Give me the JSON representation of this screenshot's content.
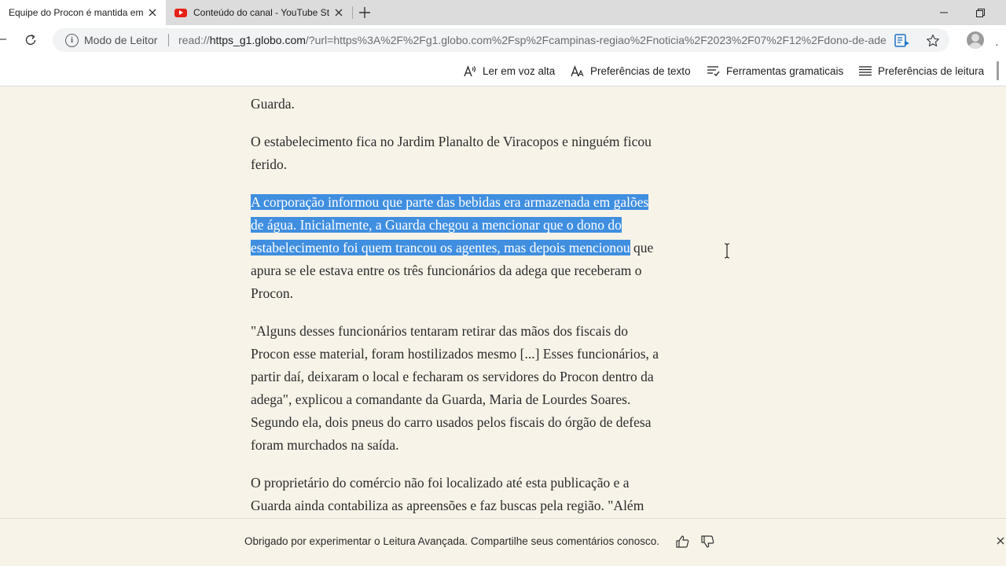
{
  "tabs": [
    {
      "title": "Equipe do Procon é mantida em",
      "active": true
    },
    {
      "title": "Conteúdo do canal - YouTube St",
      "active": false,
      "icon": "youtube-icon"
    }
  ],
  "address_bar": {
    "reader_label": "Modo de Leitor",
    "url_scheme": "read://",
    "url_host": "https_g1.globo.com",
    "url_rest": "/?url=https%3A%2F%2Fg1.globo.com%2Fsp%2Fcampinas-regiao%2Fnoticia%2F2023%2F07%2F12%2Fdono-de-adega-..."
  },
  "reader_toolbar": {
    "read_aloud": "Ler em voz alta",
    "text_prefs": "Preferências de texto",
    "grammar_tools": "Ferramentas gramaticais",
    "reading_prefs": "Preferências de leitura"
  },
  "article": {
    "p0_tail": "Guarda.",
    "p1": [
      "O estabelecimento fica no Jardim Planalto de Viracopos e ninguém ficou",
      "ferido."
    ],
    "p2_selected": [
      "A corporação informou que parte das bebidas era armazenada em galões",
      "de água. Inicialmente, a Guarda chegou a mencionar que o dono do",
      "estabelecimento foi quem trancou os agentes, mas depois mencionou"
    ],
    "p2_unselected_tail": " que",
    "p2_rest": [
      "apura se ele estava entre os três funcionários da adega que receberam o",
      "Procon."
    ],
    "p3": [
      "\"Alguns desses funcionários tentaram retirar das mãos dos fiscais do",
      "Procon esse material, foram hostilizados mesmo [...] Esses funcionários, a",
      "partir daí, deixaram o local e fecharam os servidores do Procon dentro da",
      "adega\", explicou a comandante da Guarda, Maria de Lourdes Soares.",
      "Segundo ela, dois pneus do carro usados pelos fiscais do órgão de defesa",
      "foram murchados na saída."
    ],
    "p4": [
      "O proprietário do comércio não foi localizado até esta publicação e a",
      "Guarda ainda contabiliza as apreensões e faz buscas pela região. \"Além"
    ]
  },
  "footer": {
    "feedback": "Obrigado por experimentar o Leitura Avançada. Compartilhe seus comentários conosco."
  },
  "colors": {
    "selection": "#3f8ee0",
    "reader_background": "#f7f3e8"
  }
}
